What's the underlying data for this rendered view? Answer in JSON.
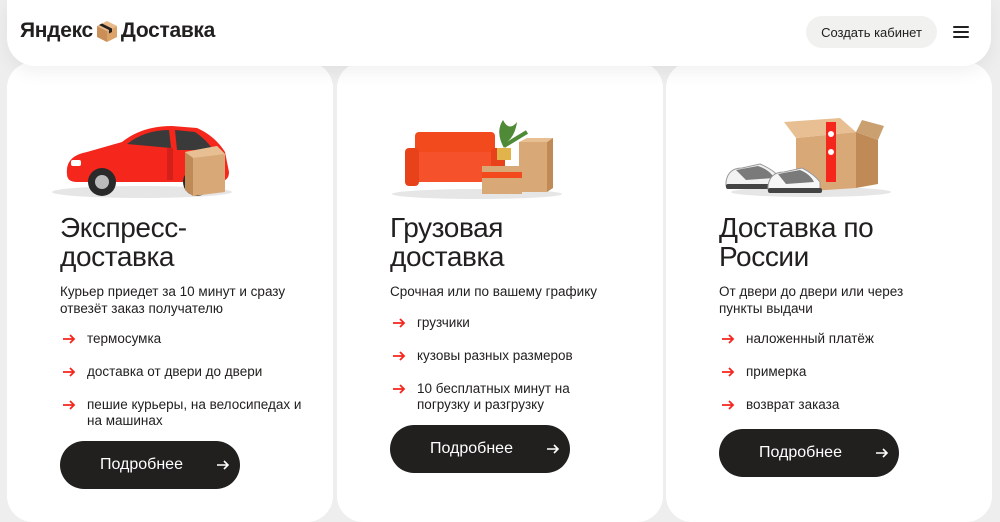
{
  "header": {
    "logo_left": "Яндекс",
    "logo_right": "Доставка",
    "cabinet_button": "Создать кабинет"
  },
  "cards": [
    {
      "title_line1": "Экспресс-",
      "title_line2": "доставка",
      "subtitle": "Курьер приедет за 10 минут и сразу отвезёт заказ получателю",
      "features": [
        "термосумка",
        "доставка от двери до двери",
        "пешие курьеры, на велосипедах и на машинах"
      ],
      "button": "Подробнее"
    },
    {
      "title_line1": "Грузовая",
      "title_line2": "доставка",
      "subtitle": "Срочная или по вашему графику",
      "features": [
        "грузчики",
        " кузовы разных размеров",
        "10 бесплатных минут на погрузку и разгрузку"
      ],
      "button": "Подробнее"
    },
    {
      "title_line1": "Доставка по",
      "title_line2": "России",
      "subtitle": "От двери до двери или через пункты выдачи",
      "features": [
        "наложенный платёж",
        "примерка",
        "возврат заказа"
      ],
      "button": "Подробнее"
    }
  ],
  "colors": {
    "accent": "#f5261b",
    "dark": "#21201f",
    "box": "#d9a877"
  }
}
